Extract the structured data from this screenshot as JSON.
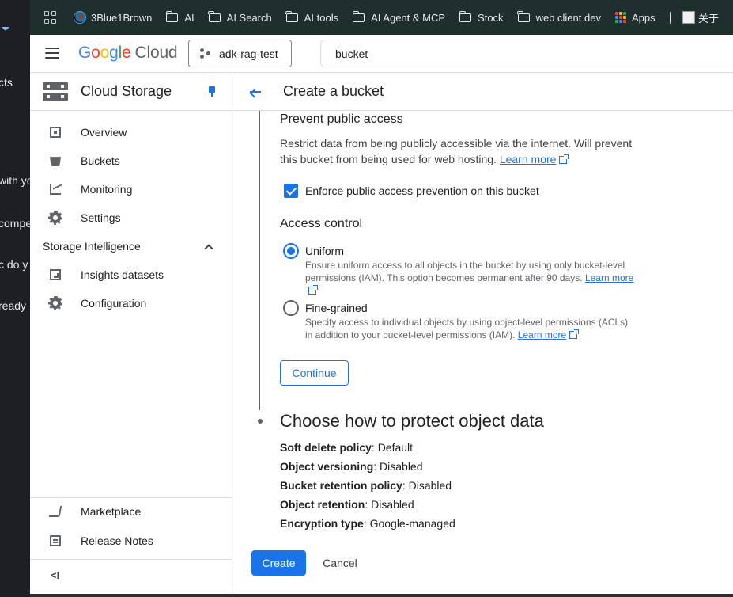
{
  "background_window": {
    "fragments": [
      "cts",
      "with yo",
      "compe",
      "c do y",
      "ready"
    ]
  },
  "bookmarks": {
    "items": [
      {
        "label": "3Blue1Brown",
        "icon": "3blue1brown-favicon"
      },
      {
        "label": "AI",
        "icon": "folder-icon"
      },
      {
        "label": "AI Search",
        "icon": "folder-icon"
      },
      {
        "label": "AI tools",
        "icon": "folder-icon"
      },
      {
        "label": "AI Agent & MCP",
        "icon": "folder-icon"
      },
      {
        "label": "Stock",
        "icon": "folder-icon"
      },
      {
        "label": "web client dev",
        "icon": "folder-icon"
      },
      {
        "label": "Apps",
        "icon": "apps-grid-icon"
      },
      {
        "label": "",
        "icon": "globe-icon"
      },
      {
        "label": "关于",
        "icon": "avatar-favicon"
      }
    ]
  },
  "topbar": {
    "brand": {
      "google": "Google",
      "cloud": "Cloud"
    },
    "project": "adk-rag-test",
    "search_value": "bucket"
  },
  "sidebar": {
    "title": "Cloud Storage",
    "items": [
      {
        "label": "Overview",
        "icon": "overview-icon"
      },
      {
        "label": "Buckets",
        "icon": "bucket-icon"
      },
      {
        "label": "Monitoring",
        "icon": "monitoring-icon"
      },
      {
        "label": "Settings",
        "icon": "gear-icon"
      }
    ],
    "section": "Storage Intelligence",
    "section_items": [
      {
        "label": "Insights datasets",
        "icon": "grid-icon"
      },
      {
        "label": "Configuration",
        "icon": "gear-icon"
      }
    ],
    "bottom": [
      {
        "label": "Marketplace",
        "icon": "cart-icon"
      },
      {
        "label": "Release Notes",
        "icon": "notes-icon"
      }
    ],
    "collapse_label": "<I"
  },
  "page": {
    "title": "Create a bucket",
    "prevent_public": {
      "heading": "Prevent public access",
      "description": "Restrict data from being publicly accessible via the internet. Will prevent this bucket from being used for web hosting.",
      "learn_more": "Learn more",
      "checkbox_label": "Enforce public access prevention on this bucket",
      "checked": true
    },
    "access_control": {
      "heading": "Access control",
      "uniform": {
        "label": "Uniform",
        "desc": "Ensure uniform access to all objects in the bucket by using only bucket-level permissions (IAM). This option becomes permanent after 90 days.",
        "learn": "Learn",
        "more": "more",
        "selected": true
      },
      "fine": {
        "label": "Fine-grained",
        "desc": "Specify access to individual objects by using object-level permissions (ACLs) in addition to your bucket-level permissions (IAM).",
        "learn_more": "Learn more",
        "selected": false
      }
    },
    "continue_label": "Continue",
    "protect": {
      "heading": "Choose how to protect object data",
      "props": [
        {
          "name": "Soft delete policy",
          "value": ": Default"
        },
        {
          "name": "Object versioning",
          "value": ": Disabled"
        },
        {
          "name": "Bucket retention policy",
          "value": ": Disabled"
        },
        {
          "name": "Object retention",
          "value": ": Disabled"
        },
        {
          "name": "Encryption type",
          "value": ": Google-managed"
        }
      ]
    },
    "create_label": "Create",
    "cancel_label": "Cancel"
  },
  "colors": {
    "accent": "#1a73e8",
    "bookmarks_bg": "#1f2f2e"
  }
}
